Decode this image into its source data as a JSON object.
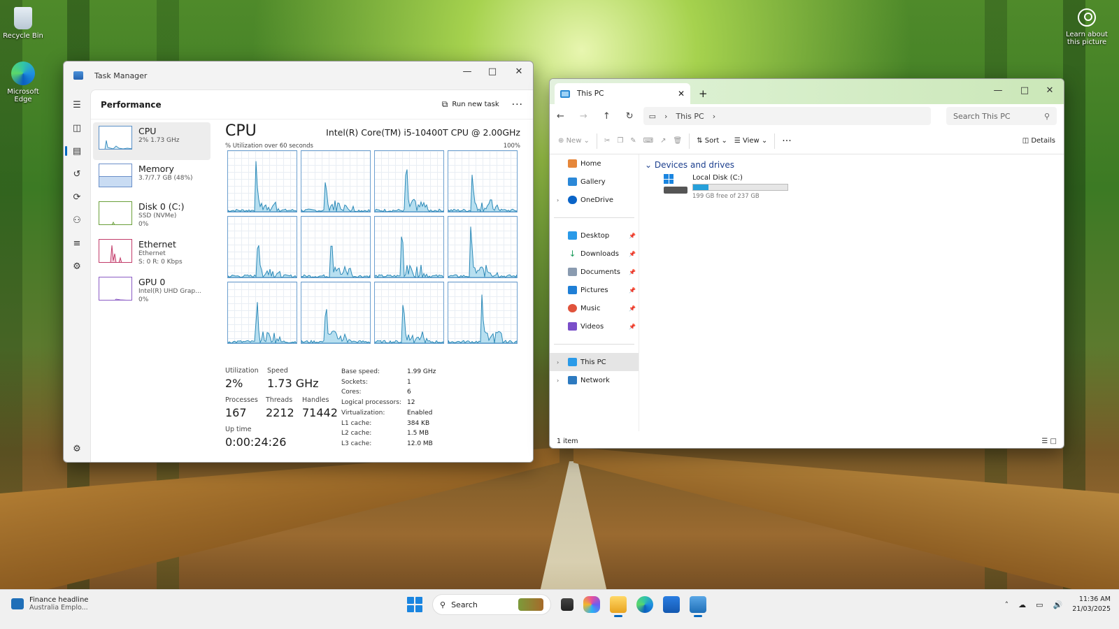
{
  "desktop": {
    "icons": [
      {
        "label": "Recycle Bin"
      },
      {
        "label": "Microsoft Edge"
      }
    ],
    "learn": "Learn about this picture"
  },
  "task_manager": {
    "title": "Task Manager",
    "section": "Performance",
    "run_new_task": "Run new task",
    "more": "···",
    "items": [
      {
        "name": "CPU",
        "line1": "2% 1.73 GHz",
        "line2": ""
      },
      {
        "name": "Memory",
        "line1": "3.7/7.7 GB (48%)",
        "line2": ""
      },
      {
        "name": "Disk 0 (C:)",
        "line1": "SSD (NVMe)",
        "line2": "0%"
      },
      {
        "name": "Ethernet",
        "line1": "Ethernet",
        "line2": "S: 0 R: 0 Kbps"
      },
      {
        "name": "GPU 0",
        "line1": "Intel(R) UHD Grap...",
        "line2": "0%"
      }
    ],
    "cpu": {
      "heading": "CPU",
      "model": "Intel(R) Core(TM) i5-10400T CPU @ 2.00GHz",
      "util_caption": "% Utilization over 60 seconds",
      "util_max": "100%",
      "stats": {
        "utilization_label": "Utilization",
        "utilization": "2%",
        "speed_label": "Speed",
        "speed": "1.73 GHz",
        "processes_label": "Processes",
        "processes": "167",
        "threads_label": "Threads",
        "threads": "2212",
        "handles_label": "Handles",
        "handles": "71442",
        "uptime_label": "Up time",
        "uptime": "0:00:24:26"
      },
      "specs": [
        {
          "k": "Base speed:",
          "v": "1.99 GHz"
        },
        {
          "k": "Sockets:",
          "v": "1"
        },
        {
          "k": "Cores:",
          "v": "6"
        },
        {
          "k": "Logical processors:",
          "v": "12"
        },
        {
          "k": "Virtualization:",
          "v": "Enabled"
        },
        {
          "k": "L1 cache:",
          "v": "384 KB"
        },
        {
          "k": "L2 cache:",
          "v": "1.5 MB"
        },
        {
          "k": "L3 cache:",
          "v": "12.0 MB"
        }
      ]
    }
  },
  "explorer": {
    "tab_title": "This PC",
    "breadcrumb": "This PC",
    "search_placeholder": "Search This PC",
    "toolbar": {
      "new": "New",
      "sort": "Sort",
      "view": "View",
      "details": "Details"
    },
    "nav": [
      {
        "label": "Home"
      },
      {
        "label": "Gallery"
      },
      {
        "label": "OneDrive"
      },
      {
        "label": "Desktop"
      },
      {
        "label": "Downloads"
      },
      {
        "label": "Documents"
      },
      {
        "label": "Pictures"
      },
      {
        "label": "Music"
      },
      {
        "label": "Videos"
      },
      {
        "label": "This PC"
      },
      {
        "label": "Network"
      }
    ],
    "group": "Devices and drives",
    "drive": {
      "name": "Local Disk (C:)",
      "free": "199 GB free of 237 GB",
      "used_fraction": 0.16
    },
    "status": "1 item"
  },
  "taskbar": {
    "widget_title": "Finance headline",
    "widget_sub": "Australia Emplo...",
    "search": "Search",
    "time": "11:36 AM",
    "date": "21/03/2025"
  }
}
